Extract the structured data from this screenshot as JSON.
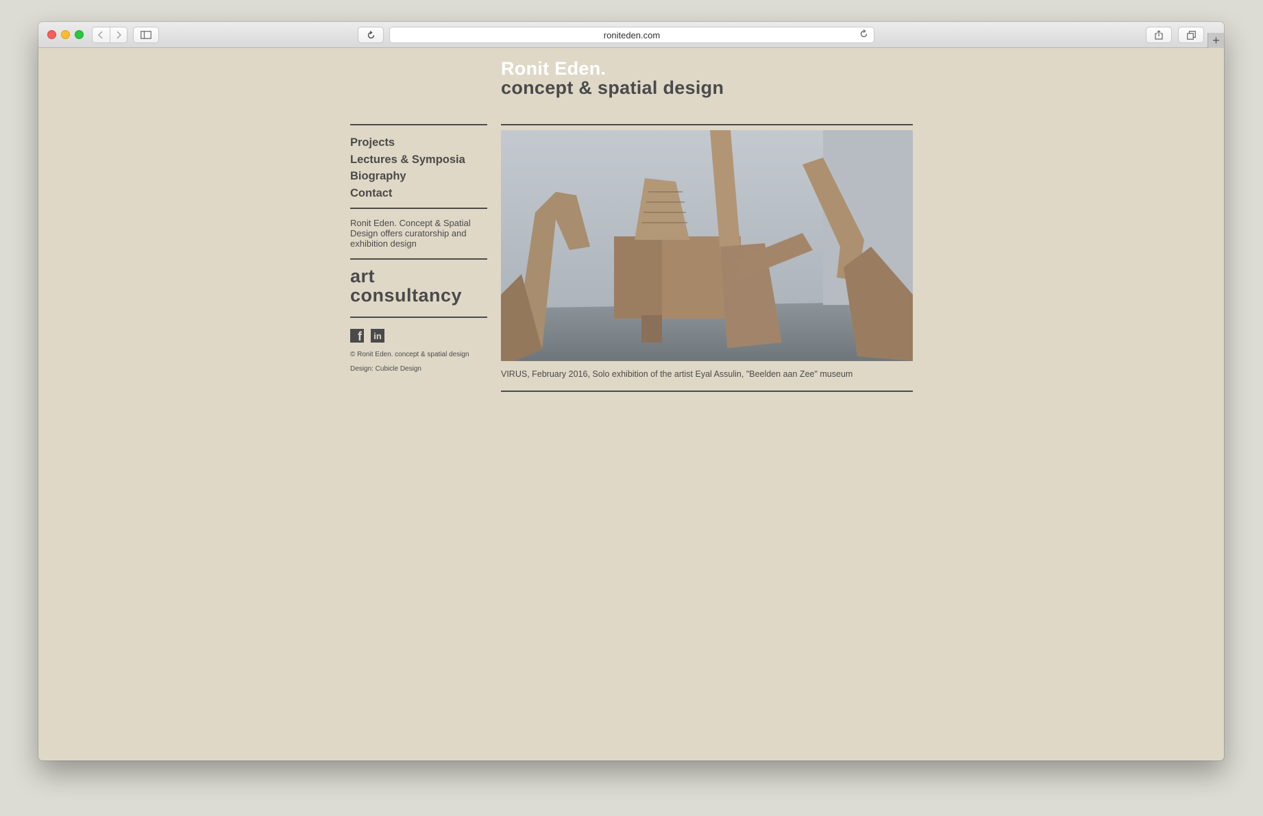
{
  "browser": {
    "url": "roniteden.com"
  },
  "site": {
    "name": "Ronit Eden.",
    "tagline": "concept & spatial design"
  },
  "nav": {
    "items": [
      "Projects",
      "Lectures & Symposia",
      "Biography",
      "Contact"
    ]
  },
  "blurb": "Ronit Eden. Concept & Spatial Design offers curatorship and exhibition design",
  "art_consultancy": {
    "line1": "art",
    "line2": "consultancy"
  },
  "social": {
    "facebook_glyph": "f",
    "linkedin_glyph": "in"
  },
  "footer": {
    "copyright": "© Ronit Eden. concept & spatial design",
    "credit": "Design: Cubicle Design"
  },
  "feature": {
    "caption": "VIRUS, February 2016, Solo exhibition of the artist Eyal Assulin, \"Beelden aan Zee\" museum"
  },
  "colors": {
    "page_bg": "#dfd8c6",
    "text": "#4a4a4b",
    "title_highlight": "#ffffff"
  }
}
